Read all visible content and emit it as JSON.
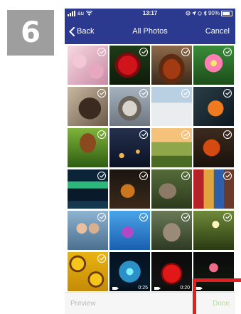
{
  "step": {
    "number": "6",
    "badge_color": "#9e9e9e"
  },
  "status_bar": {
    "carrier": "au",
    "time": "13:17",
    "battery": "90%"
  },
  "nav": {
    "back_label": "Back",
    "title": "All Photos",
    "cancel_label": "Cancel",
    "bar_color": "#2b3a8e"
  },
  "photos": [
    {
      "subject": "pink flowers",
      "selected": true
    },
    {
      "subject": "red rose",
      "selected": true
    },
    {
      "subject": "rooster",
      "selected": true
    },
    {
      "subject": "pink daisy",
      "selected": true
    },
    {
      "subject": "photographer with camera",
      "selected": true
    },
    {
      "subject": "wolf in snow",
      "selected": true
    },
    {
      "subject": "snowy forest",
      "selected": true
    },
    {
      "subject": "orange autumn leaf",
      "selected": true
    },
    {
      "subject": "mushroom",
      "selected": true
    },
    {
      "subject": "city at night",
      "selected": true
    },
    {
      "subject": "countryside landscape",
      "selected": true
    },
    {
      "subject": "red maple leaves",
      "selected": true
    },
    {
      "subject": "aurora over lake",
      "selected": true
    },
    {
      "subject": "glass of whisky",
      "selected": true
    },
    {
      "subject": "cat and dog on steps",
      "selected": true
    },
    {
      "subject": "colorful riverside houses",
      "selected": true
    },
    {
      "subject": "couple taking selfie",
      "selected": true
    },
    {
      "subject": "purple flower blue sky",
      "selected": true
    },
    {
      "subject": "squirrel",
      "selected": true
    },
    {
      "subject": "tree with sun rays",
      "selected": true
    },
    {
      "subject": "sunflowers",
      "selected": true
    },
    {
      "subject": "glowing planet",
      "video": true,
      "duration": "0:25"
    },
    {
      "subject": "red apple",
      "video": true,
      "duration": "0:20"
    },
    {
      "subject": "pink tulip",
      "video": true,
      "duration": ""
    }
  ],
  "toolbar": {
    "preview_label": "Preview",
    "done_label": "Done",
    "done_color": "#b9d99c"
  },
  "highlight_color": "#e02020"
}
